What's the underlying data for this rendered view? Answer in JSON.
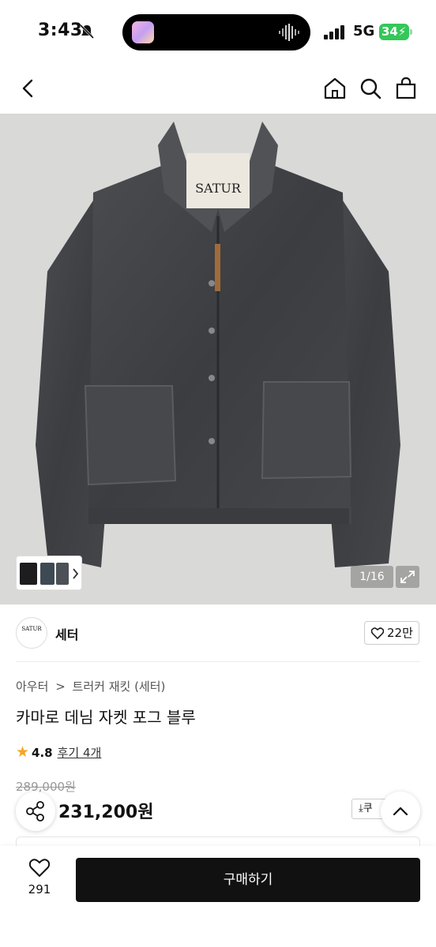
{
  "status_bar": {
    "time": "3:43",
    "network": "5G",
    "battery": "34"
  },
  "product_image": {
    "counter": "1/16",
    "label_text": "SATUR"
  },
  "brand": {
    "logo_text": "SATUR",
    "name": "세터",
    "like_count": "22만"
  },
  "breadcrumb": {
    "category": "아우터",
    "separator": ">",
    "subcategory": "트러커 재킷 (세터)"
  },
  "product": {
    "title": "카마로 데님 자켓 포그 블루",
    "rating": "4.8",
    "reviews": "후기 4개",
    "original_price": "289,000원",
    "sale_price": "231,200원",
    "coupon_label": "쿠"
  },
  "bottom_bar": {
    "wish_count": "291",
    "buy_label": "구매하기"
  },
  "colors": {
    "accent_star": "#f5a623",
    "battery": "#34c759",
    "buy_button": "#111111"
  }
}
